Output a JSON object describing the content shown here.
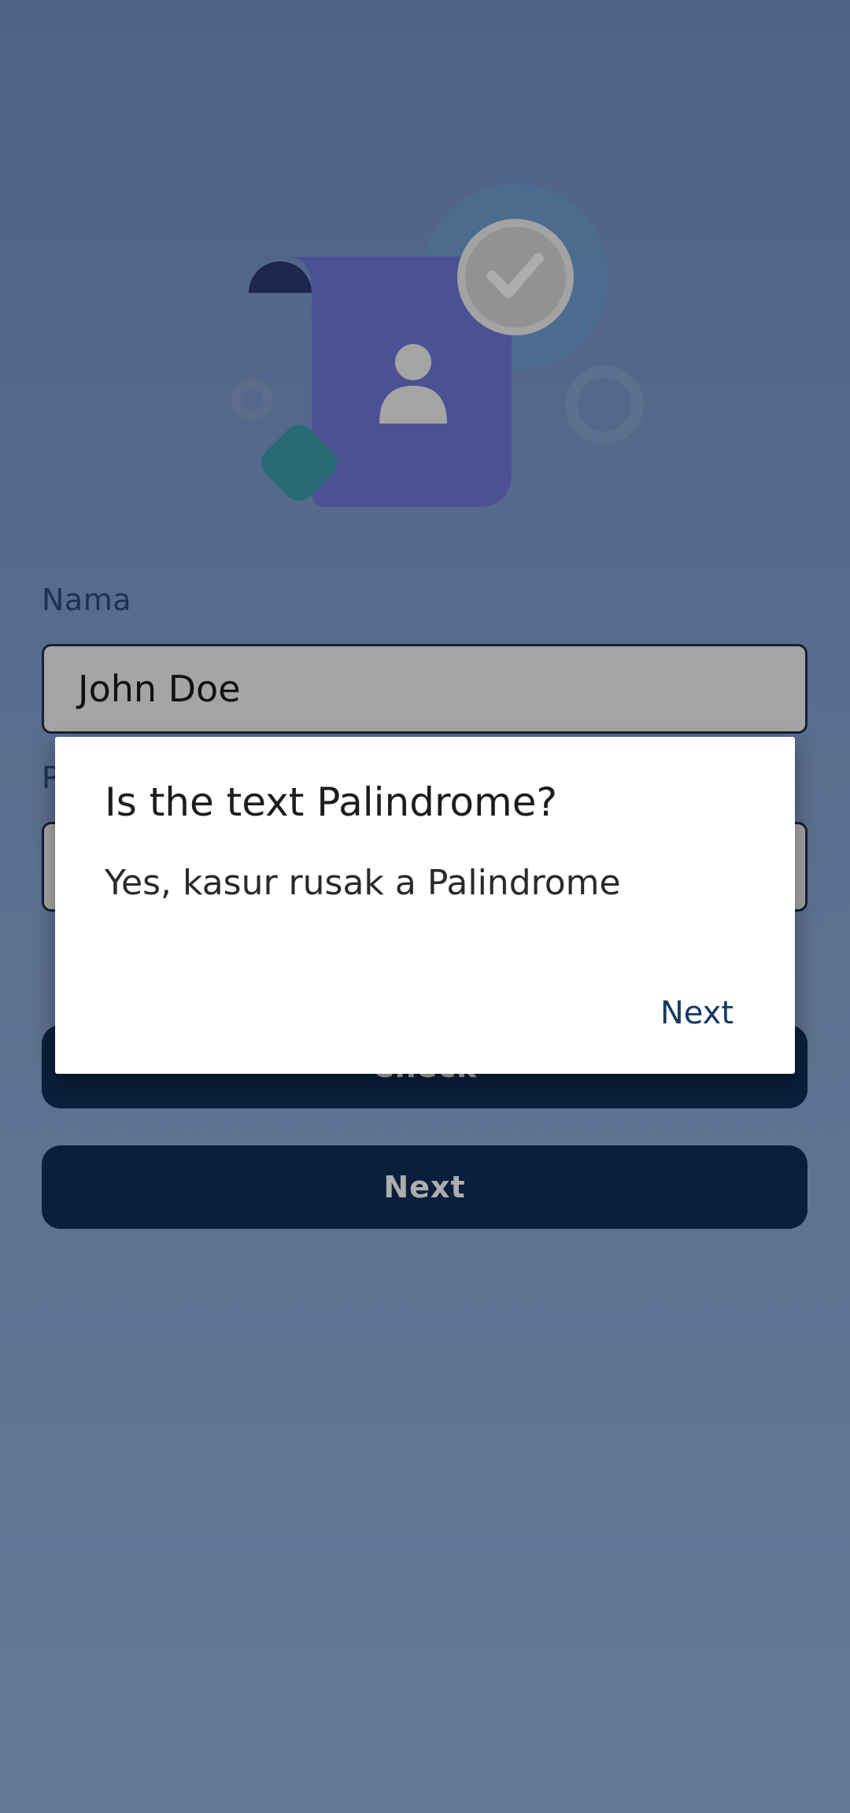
{
  "form": {
    "name_label": "Nama",
    "name_value": "John Doe",
    "palindrome_label": "P",
    "palindrome_value": ""
  },
  "buttons": {
    "check_label": "Check",
    "next_label": "Next"
  },
  "dialog": {
    "title": "Is the text Palindrome?",
    "message": "Yes, kasur rusak a Palindrome",
    "action_label": "Next"
  },
  "colors": {
    "background_top": "#7391c8",
    "background_bottom": "#94b3e0",
    "button": "#102f57",
    "dialog_action": "#133a63"
  },
  "icons": {
    "hero": "profile-card-check-illustration"
  }
}
